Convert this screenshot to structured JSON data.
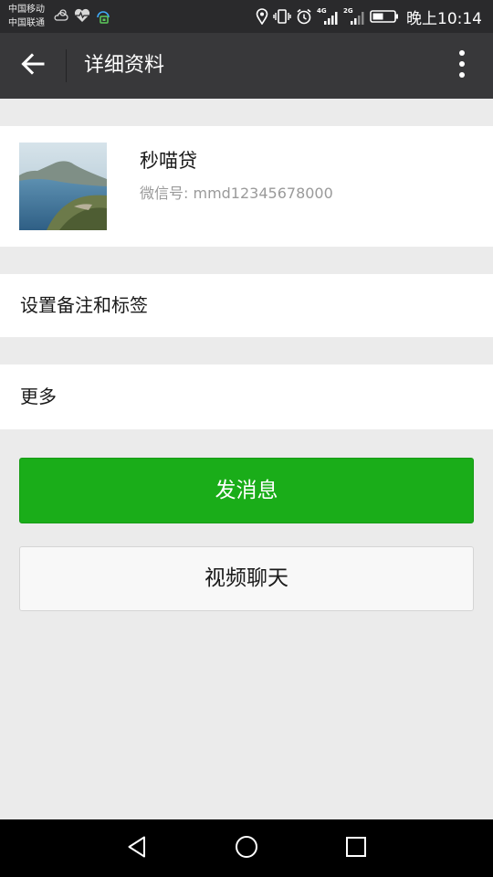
{
  "status_bar": {
    "carrier_1": "中国移动",
    "carrier_2": "中国联通",
    "network_tag_1": "4G",
    "network_tag_2": "2G",
    "time": "晚上10:14",
    "icons": [
      "weather-cloud-icon",
      "health-heart-icon",
      "vpn-lock-icon",
      "location-icon",
      "vibrate-icon",
      "alarm-icon",
      "signal-4g-icon",
      "signal-2g-icon",
      "battery-icon"
    ]
  },
  "action_bar": {
    "title": "详细资料",
    "back_icon": "arrow-left-icon",
    "more_icon": "more-vertical-icon"
  },
  "profile": {
    "name": "秒喵贷",
    "wechat_id": "微信号: mmd12345678000",
    "avatar": "landscape-photo"
  },
  "rows": {
    "remark_label": "设置备注和标签",
    "more_label": "更多"
  },
  "buttons": {
    "send_message": "发消息",
    "video_chat": "视频聊天"
  },
  "nav_bar": {
    "icons": [
      "triangle-back-icon",
      "circle-home-icon",
      "square-recent-icon"
    ]
  },
  "colors": {
    "primary_green": "#1aad19",
    "action_bar": "#38383a",
    "status_bar": "#2a2a2c",
    "background": "#ebebeb"
  }
}
